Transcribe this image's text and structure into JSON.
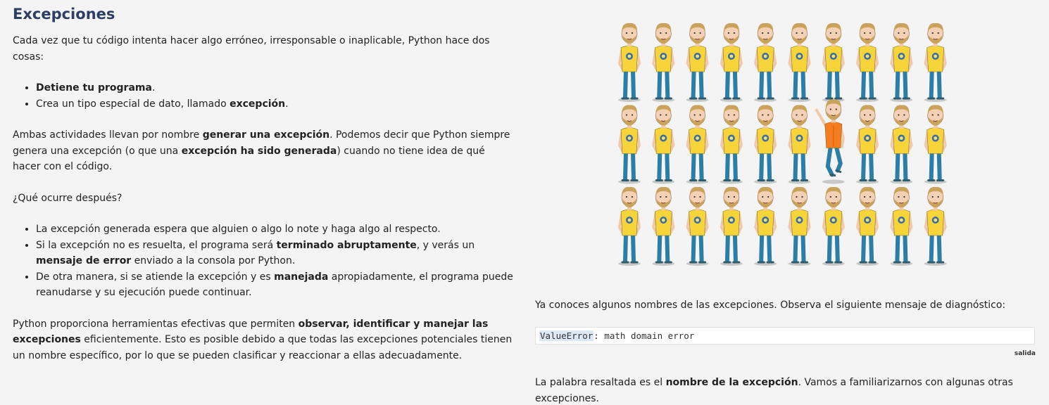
{
  "title": "Excepciones",
  "intro": "Cada vez que tu código intenta hacer algo erróneo, irresponsable o inaplicable, Python hace dos cosas:",
  "list1": {
    "item1": {
      "bold": "Detiene tu programa",
      "rest": "."
    },
    "item2": {
      "text": "Crea un tipo especial de dato, llamado ",
      "bold": "excepción",
      "rest": "."
    }
  },
  "para2": {
    "t1": "Ambas actividades llevan por nombre ",
    "b1": "generar una excepción",
    "t2": ". Podemos decir que Python siempre genera una excepción (o que una ",
    "b2": "excepción ha sido generada",
    "t3": ") cuando no tiene idea de qué hacer con el código."
  },
  "question": "¿Qué ocurre después?",
  "list2": {
    "item1": "La excepción generada espera que alguien o algo lo note y haga algo al respecto.",
    "item2": {
      "t1": "Si la excepción no es resuelta, el programa será ",
      "b1": "terminado abruptamente",
      "t2": ", y verás un ",
      "b2": "mensaje de error",
      "t3": " enviado a la consola por Python."
    },
    "item3": {
      "t1": "De otra manera, si se atiende la excepción y es ",
      "b1": "manejada",
      "t2": " apropiadamente, el programa puede reanudarse y su ejecución puede continuar."
    }
  },
  "para3": {
    "t1": "Python proporciona herramientas efectivas que permiten ",
    "b1": "observar, identificar y manejar las excepciones",
    "t2": " eficientemente. Esto es posible debido a que todas las excepciones potenciales tienen un nombre específico, por lo que se pueden clasificar y reaccionar a ellas adecuadamente."
  },
  "right": {
    "text1": "Ya conoces algunos nombres de las excepciones. Observa el siguiente mensaje de diagnóstico:",
    "code_exception": "ValueError",
    "code_rest": ": math domain error",
    "output_label": "salida",
    "text2": {
      "t1": "La palabra resaltada es el ",
      "b1": "nombre de la excepción",
      "t2": ". Vamos a familiarizarnos con algunas otras excepciones."
    }
  },
  "illustration": {
    "rows": 3,
    "cols": 10,
    "odd_one": {
      "row": 1,
      "col": 6
    },
    "shirt_color": "#f7d43a",
    "odd_shirt_color": "#f57c1f",
    "pants_color": "#2b7fa4",
    "hair_color": "#c9a25c"
  },
  "colors": {
    "title": "#2c3f63",
    "code_highlight": "#dde8f7"
  }
}
